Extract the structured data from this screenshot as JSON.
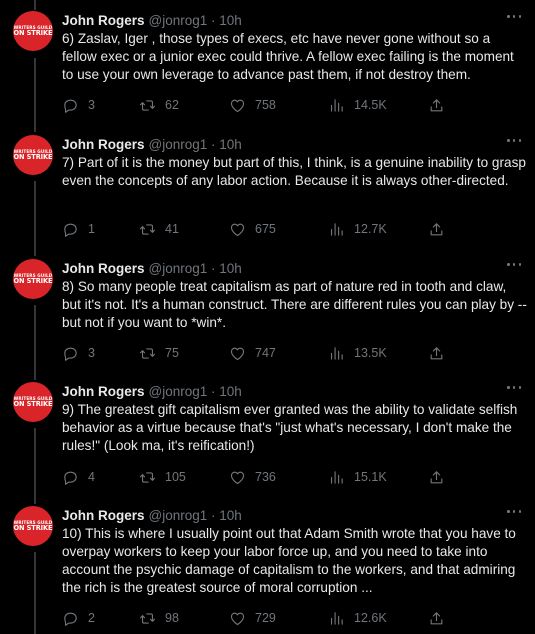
{
  "colors": {
    "background": "#000000",
    "text": "#e7e9ea",
    "muted": "#71767b",
    "thread_line": "#333639",
    "avatar_red": "#d9252a"
  },
  "avatar": {
    "line1": "WRITERS GUILD",
    "line2": "ON STRIKE"
  },
  "tweets": [
    {
      "name": "John Rogers",
      "handle": "@jonrog1 · 10h",
      "text": "6) Zaslav, Iger , those types of execs, etc have never gone without so a fellow exec or a junior exec could thrive. A fellow exec failing is the moment to use your own leverage to advance past them, if not destroy them.",
      "replies": "3",
      "retweets": "62",
      "likes": "758",
      "views": "14.5K"
    },
    {
      "name": "John Rogers",
      "handle": "@jonrog1 · 10h",
      "text": "7) Part of it is the money but part of this, I think, is a genuine inability to grasp even the concepts of any labor action. Because it is always other-directed.",
      "replies": "1",
      "retweets": "41",
      "likes": "675",
      "views": "12.7K"
    },
    {
      "name": "John Rogers",
      "handle": "@jonrog1 · 10h",
      "text": "8) So many people treat capitalism as part of nature red in tooth and claw, but it's not. It's a human construct.  There are different rules you can play by -- but not if you want to *win*.",
      "replies": "3",
      "retweets": "75",
      "likes": "747",
      "views": "13.5K"
    },
    {
      "name": "John Rogers",
      "handle": "@jonrog1 · 10h",
      "text": "9) The greatest gift capitalism ever granted was the ability to validate selfish behavior as a virtue because that's \"just what's necessary, I don't make the rules!\" (Look ma, it's reification!)",
      "replies": "4",
      "retweets": "105",
      "likes": "736",
      "views": "15.1K"
    },
    {
      "name": "John Rogers",
      "handle": "@jonrog1 · 10h",
      "text": "10) This is where I usually point out that Adam Smith wrote  that you have to overpay workers to keep your labor force up, and you need to take into account the psychic damage of capitalism to the workers, and that admiring the rich is the greatest source of moral corruption ...",
      "replies": "2",
      "retweets": "98",
      "likes": "729",
      "views": "12.6K"
    }
  ]
}
